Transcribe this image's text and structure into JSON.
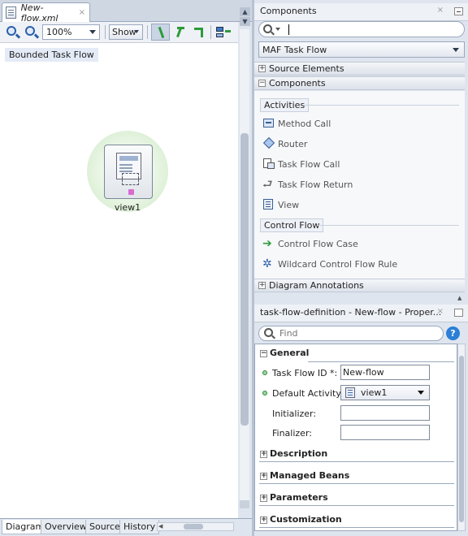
{
  "editor": {
    "file_tab": "New-flow.xml",
    "file_tab_close": "×",
    "zoom_value": "100%",
    "show_label": "Show",
    "diagram_label": "Bounded Task Flow",
    "view_node_label": "view1",
    "bottom_tabs": [
      "Diagram",
      "Overview",
      "Source",
      "History"
    ],
    "active_tab": "Diagram"
  },
  "components": {
    "title": "Components",
    "close_x": "×",
    "search_placeholder": "",
    "catalog": "MAF Task Flow",
    "sections": [
      "Source Elements",
      "Components",
      "Diagram Annotations"
    ],
    "section_states": [
      "+",
      "−",
      "+"
    ],
    "groups": [
      "Activities",
      "Control Flow"
    ],
    "activities": [
      "Method Call",
      "Router",
      "Task Flow Call",
      "Task Flow Return",
      "View"
    ],
    "control_flow": [
      "Control Flow Case",
      "Wildcard Control Flow Rule"
    ]
  },
  "properties": {
    "title": "task-flow-definition - New-flow - Proper...",
    "close_x": "×",
    "find_placeholder": "Find",
    "help": "?",
    "sections": [
      "General",
      "Description",
      "Managed Beans",
      "Parameters",
      "Customization"
    ],
    "section_states": [
      "−",
      "+",
      "+",
      "+",
      "+"
    ],
    "fields": {
      "task_flow_id_label": "Task Flow ID *:",
      "task_flow_id_value": "New-flow",
      "default_activity_label": "Default Activity:",
      "default_activity_value": "view1",
      "initializer_label": "Initializer:",
      "initializer_value": "",
      "finalizer_label": "Finalizer:",
      "finalizer_value": ""
    }
  },
  "colors": {
    "accent": "#2b5fa8",
    "flow_green": "#2e9a3a",
    "node_glow": "#cfe9c7"
  }
}
